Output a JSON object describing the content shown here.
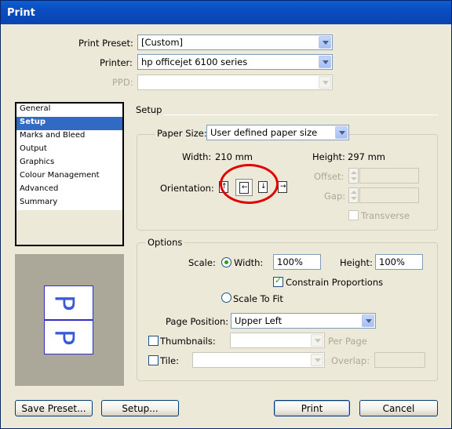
{
  "window": {
    "title": "Print"
  },
  "top": {
    "preset_label": "Print Preset:",
    "preset_value": "[Custom]",
    "printer_label": "Printer:",
    "printer_value": "hp officejet 6100 series",
    "ppd_label": "PPD:",
    "ppd_value": ""
  },
  "sidebar": {
    "items": [
      {
        "label": "General"
      },
      {
        "label": "Setup"
      },
      {
        "label": "Marks and Bleed"
      },
      {
        "label": "Output"
      },
      {
        "label": "Graphics"
      },
      {
        "label": "Colour Management"
      },
      {
        "label": "Advanced"
      },
      {
        "label": "Summary"
      }
    ],
    "selected": "Setup"
  },
  "setup": {
    "section_title": "Setup",
    "paper_size_label": "Paper Size:",
    "paper_size_value": "User defined paper size",
    "width_label": "Width:",
    "width_value": "210 mm",
    "height_label": "Height:",
    "height_value": "297 mm",
    "offset_label": "Offset:",
    "gap_label": "Gap:",
    "orientation_label": "Orientation:",
    "orientations": [
      "portrait",
      "landscape",
      "reverse-portrait",
      "reverse-landscape"
    ],
    "transverse_label": "Transverse"
  },
  "options": {
    "title": "Options",
    "scale_label": "Scale:",
    "width_label": "Width:",
    "width_value": "100%",
    "height_label": "Height:",
    "height_value": "100%",
    "constrain_label": "Constrain Proportions",
    "scale_to_fit_label": "Scale To Fit",
    "page_position_label": "Page Position:",
    "page_position_value": "Upper Left",
    "thumbnails_label": "Thumbnails:",
    "per_page_label": "Per Page",
    "tile_label": "Tile:",
    "overlap_label": "Overlap:"
  },
  "preview": {
    "letter": "P"
  },
  "buttons": {
    "save_preset": "Save Preset...",
    "setup": "Setup...",
    "print": "Print",
    "cancel": "Cancel"
  },
  "colors": {
    "titlebar": "#0a5fd8",
    "selection": "#316ac5",
    "highlight_circle": "#e00000"
  }
}
